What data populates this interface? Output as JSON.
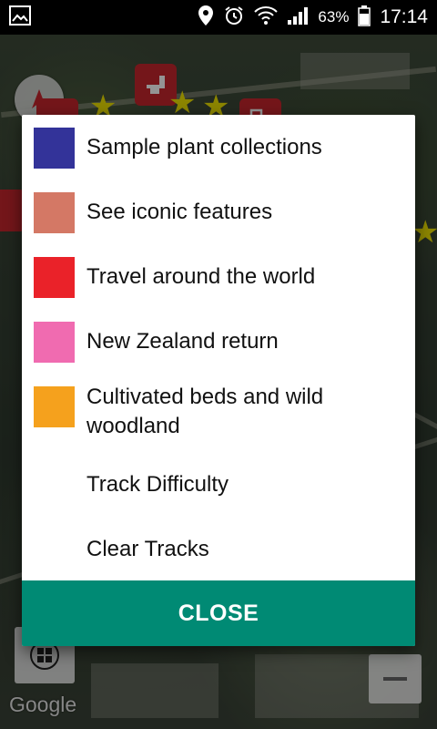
{
  "status_bar": {
    "battery": "63%",
    "time": "17:14"
  },
  "map": {
    "attribution": "Google"
  },
  "dialog": {
    "items": [
      {
        "label": "Sample plant collections",
        "color": "#333399"
      },
      {
        "label": "See iconic features",
        "color": "#d47865"
      },
      {
        "label": "Travel around the world",
        "color": "#ea2229"
      },
      {
        "label": "New Zealand return",
        "color": "#f06bb0"
      },
      {
        "label": "Cultivated beds and wild woodland",
        "color": "#f5a11d"
      },
      {
        "label": "Track Difficulty"
      },
      {
        "label": "Clear Tracks"
      }
    ],
    "close_label": "CLOSE",
    "close_color": "#008a74"
  }
}
